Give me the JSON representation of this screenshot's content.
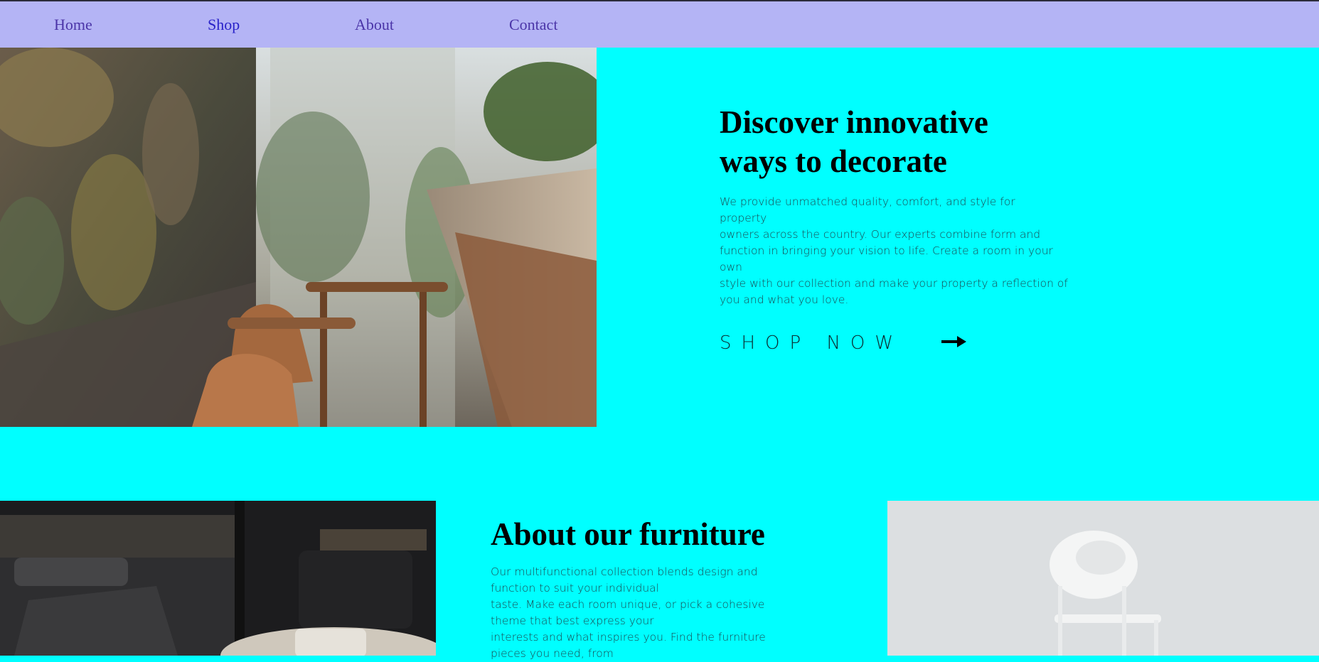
{
  "nav": {
    "home": "Home",
    "shop": "Shop",
    "about": "About",
    "contact": "Contact"
  },
  "hero": {
    "title_line1": "Discover innovative",
    "title_line2": "ways to decorate",
    "desc_lines": [
      "We provide unmatched quality, comfort, and style for",
      "property",
      "owners across the country. Our experts combine form and",
      "function in bringing your vision to life. Create a room in your",
      "own",
      "style with our collection and make your property a reflection of",
      "you and what you love."
    ],
    "cta_label": "SHOP NOW",
    "cta_icon": "arrow-right-icon"
  },
  "about": {
    "title": "About our furniture",
    "desc_lines": [
      "Our multifunctional collection blends design and",
      "function to suit your individual",
      "taste. Make each room unique, or pick a cohesive",
      "theme that best express your",
      "interests and what inspires you. Find the furniture",
      "pieces you need, from"
    ]
  },
  "colors": {
    "page_background": "#00ffff",
    "nav_background": "#b4b4f5",
    "nav_link": "#4b35a8",
    "nav_link_active": "#2a23c9"
  }
}
